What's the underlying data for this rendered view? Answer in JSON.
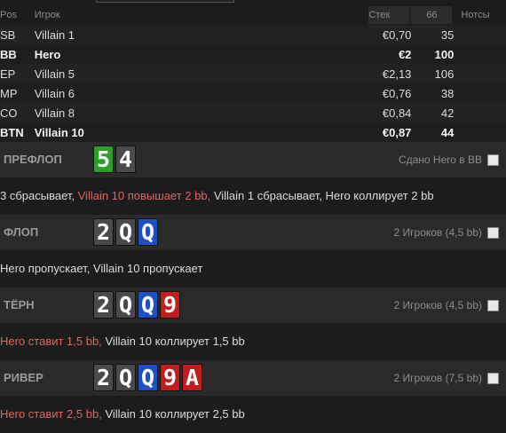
{
  "table": {
    "headers": {
      "pos": "Pos",
      "player": "Игрок",
      "stack": "Стек",
      "hands": "66",
      "notes": "Нотсы"
    },
    "rows": [
      {
        "pos": "SB",
        "player": "Villain 1",
        "stack": "€0,70",
        "hands": "35",
        "bold": false
      },
      {
        "pos": "BB",
        "player": "Hero",
        "stack": "€2",
        "hands": "100",
        "bold": true
      },
      {
        "pos": "EP",
        "player": "Villain 5",
        "stack": "€2,13",
        "hands": "106",
        "bold": false
      },
      {
        "pos": "MP",
        "player": "Villain 6",
        "stack": "€0,76",
        "hands": "38",
        "bold": false
      },
      {
        "pos": "CO",
        "player": "Villain 8",
        "stack": "€0,84",
        "hands": "42",
        "bold": false
      },
      {
        "pos": "BTN",
        "player": "Villain 10",
        "stack": "€0,87",
        "hands": "44",
        "bold": true
      }
    ]
  },
  "streets": {
    "preflop": {
      "name": "ПРЕФЛОП",
      "cards": [
        {
          "rank": "5",
          "suit": "clubs"
        },
        {
          "rank": "4",
          "suit": "spades",
          "white": true
        }
      ],
      "info": "Сдано Hero в BB",
      "actions": [
        {
          "text": "3 сбрасывает, ",
          "red": false
        },
        {
          "text": "Villain 10 повышает 2 bb,",
          "red": true
        },
        {
          "text": " Villain 1 сбрасывает, Hero коллирует 2 bb",
          "red": false
        }
      ]
    },
    "flop": {
      "name": "ФЛОП",
      "cards": [
        {
          "rank": "2",
          "suit": "spades"
        },
        {
          "rank": "Q",
          "suit": "spades"
        },
        {
          "rank": "Q",
          "suit": "diamonds"
        }
      ],
      "info": "2 Игроков (4,5 bb)",
      "actions": [
        {
          "text": "Hero пропускает, Villain 10 пропускает",
          "red": false
        }
      ]
    },
    "turn": {
      "name": "ТЁРН",
      "cards": [
        {
          "rank": "2",
          "suit": "spades"
        },
        {
          "rank": "Q",
          "suit": "spades"
        },
        {
          "rank": "Q",
          "suit": "diamonds"
        },
        {
          "rank": "9",
          "suit": "hearts"
        }
      ],
      "info": "2 Игроков (4,5 bb)",
      "actions": [
        {
          "text": "Hero ставит 1,5 bb,",
          "red": true
        },
        {
          "text": " Villain 10 коллирует 1,5 bb",
          "red": false
        }
      ]
    },
    "river": {
      "name": "РИВЕР",
      "cards": [
        {
          "rank": "2",
          "suit": "spades"
        },
        {
          "rank": "Q",
          "suit": "spades"
        },
        {
          "rank": "Q",
          "suit": "diamonds"
        },
        {
          "rank": "9",
          "suit": "hearts"
        },
        {
          "rank": "A",
          "suit": "hearts"
        }
      ],
      "info": "2 Игроков (7,5 bb)",
      "actions": [
        {
          "text": "Hero ставит 2,5 bb,",
          "red": true
        },
        {
          "text": " Villain 10 коллирует 2,5 bb",
          "red": false
        }
      ]
    }
  },
  "colors": {
    "clubs": "#2f9d2a",
    "spades": "#4a4a4a",
    "diamonds": "#1d50c2",
    "hearts": "#c21d1d",
    "bet_text": "#e06464"
  }
}
